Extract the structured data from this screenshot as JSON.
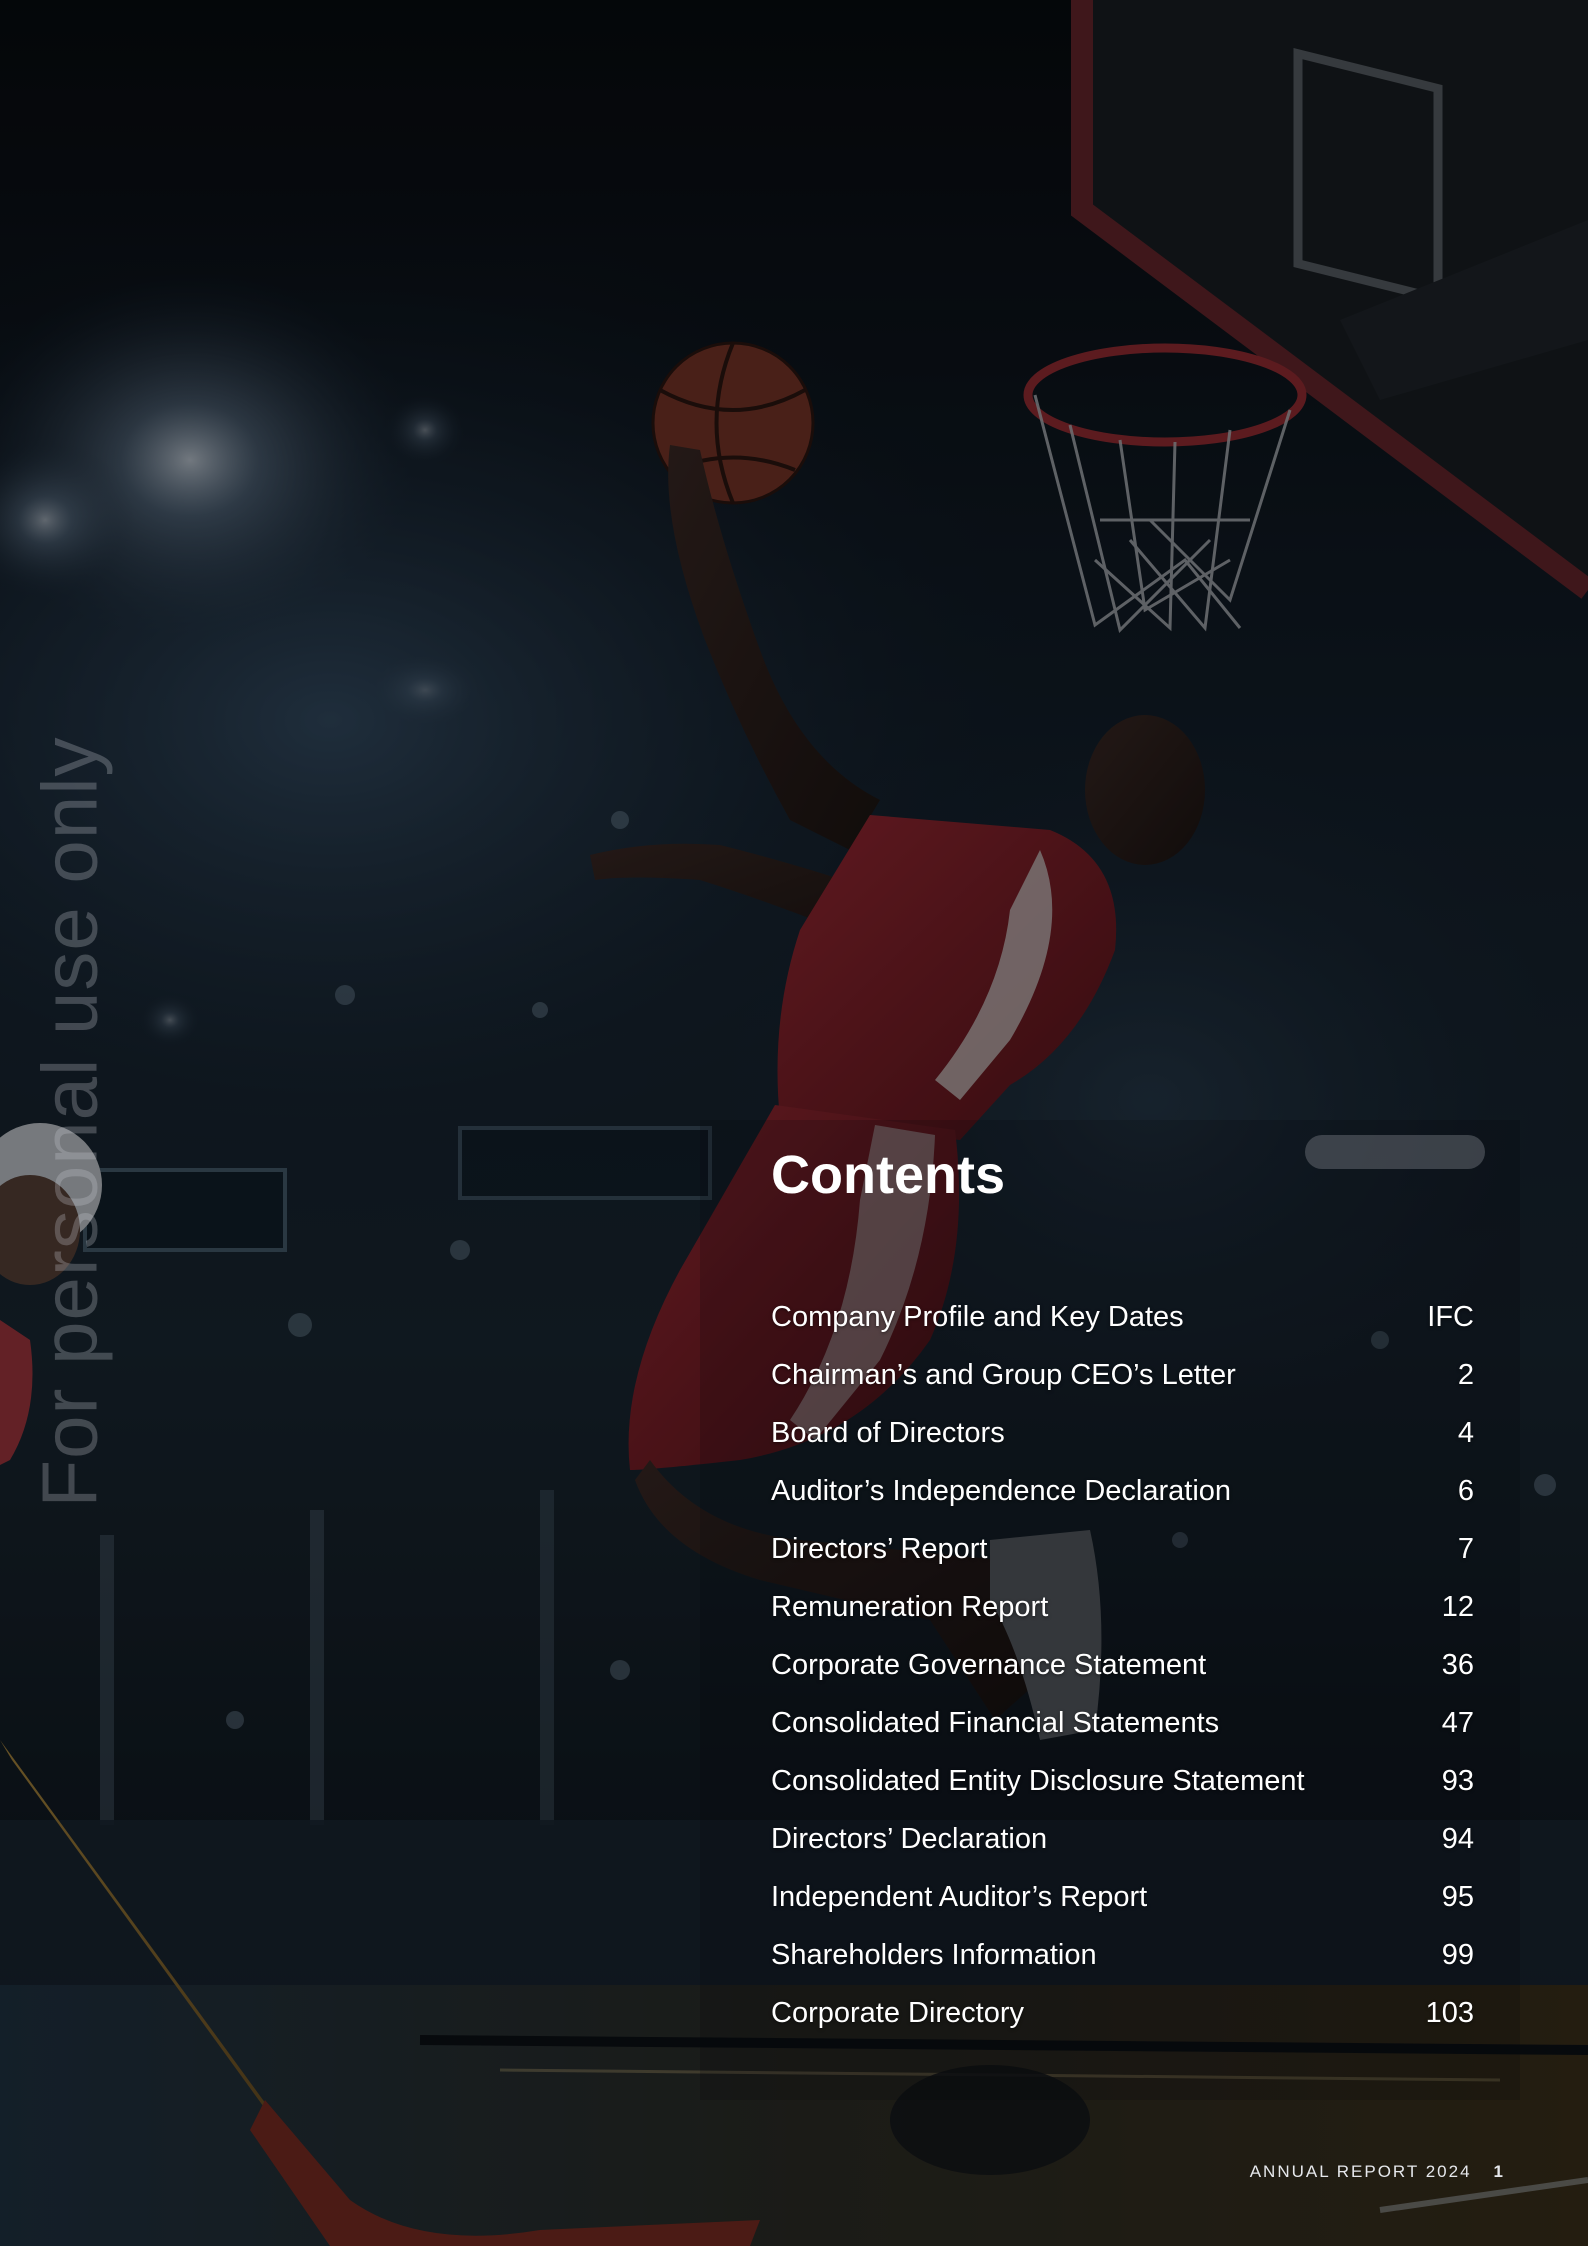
{
  "watermark": "For personal use only",
  "contents": {
    "title": "Contents",
    "items": [
      {
        "label": "Company Profile and Key Dates",
        "page": "IFC"
      },
      {
        "label": "Chairman’s and Group CEO’s Letter",
        "page": "2"
      },
      {
        "label": "Board of Directors",
        "page": "4"
      },
      {
        "label": "Auditor’s Independence Declaration",
        "page": "6"
      },
      {
        "label": "Directors’ Report",
        "page": "7"
      },
      {
        "label": "Remuneration Report",
        "page": "12"
      },
      {
        "label": "Corporate Governance Statement",
        "page": "36"
      },
      {
        "label": "Consolidated Financial Statements",
        "page": "47"
      },
      {
        "label": "Consolidated Entity Disclosure Statement",
        "page": "93"
      },
      {
        "label": "Directors’ Declaration",
        "page": "94"
      },
      {
        "label": "Independent Auditor’s Report",
        "page": "95"
      },
      {
        "label": "Shareholders Information",
        "page": "99"
      },
      {
        "label": "Corporate Directory",
        "page": "103"
      }
    ]
  },
  "footer": {
    "report_label": "ANNUAL REPORT 2024",
    "page_number": "1"
  },
  "colors": {
    "background": "#05070b",
    "text": "#ffffff",
    "jersey_red": "#8e1d24"
  }
}
